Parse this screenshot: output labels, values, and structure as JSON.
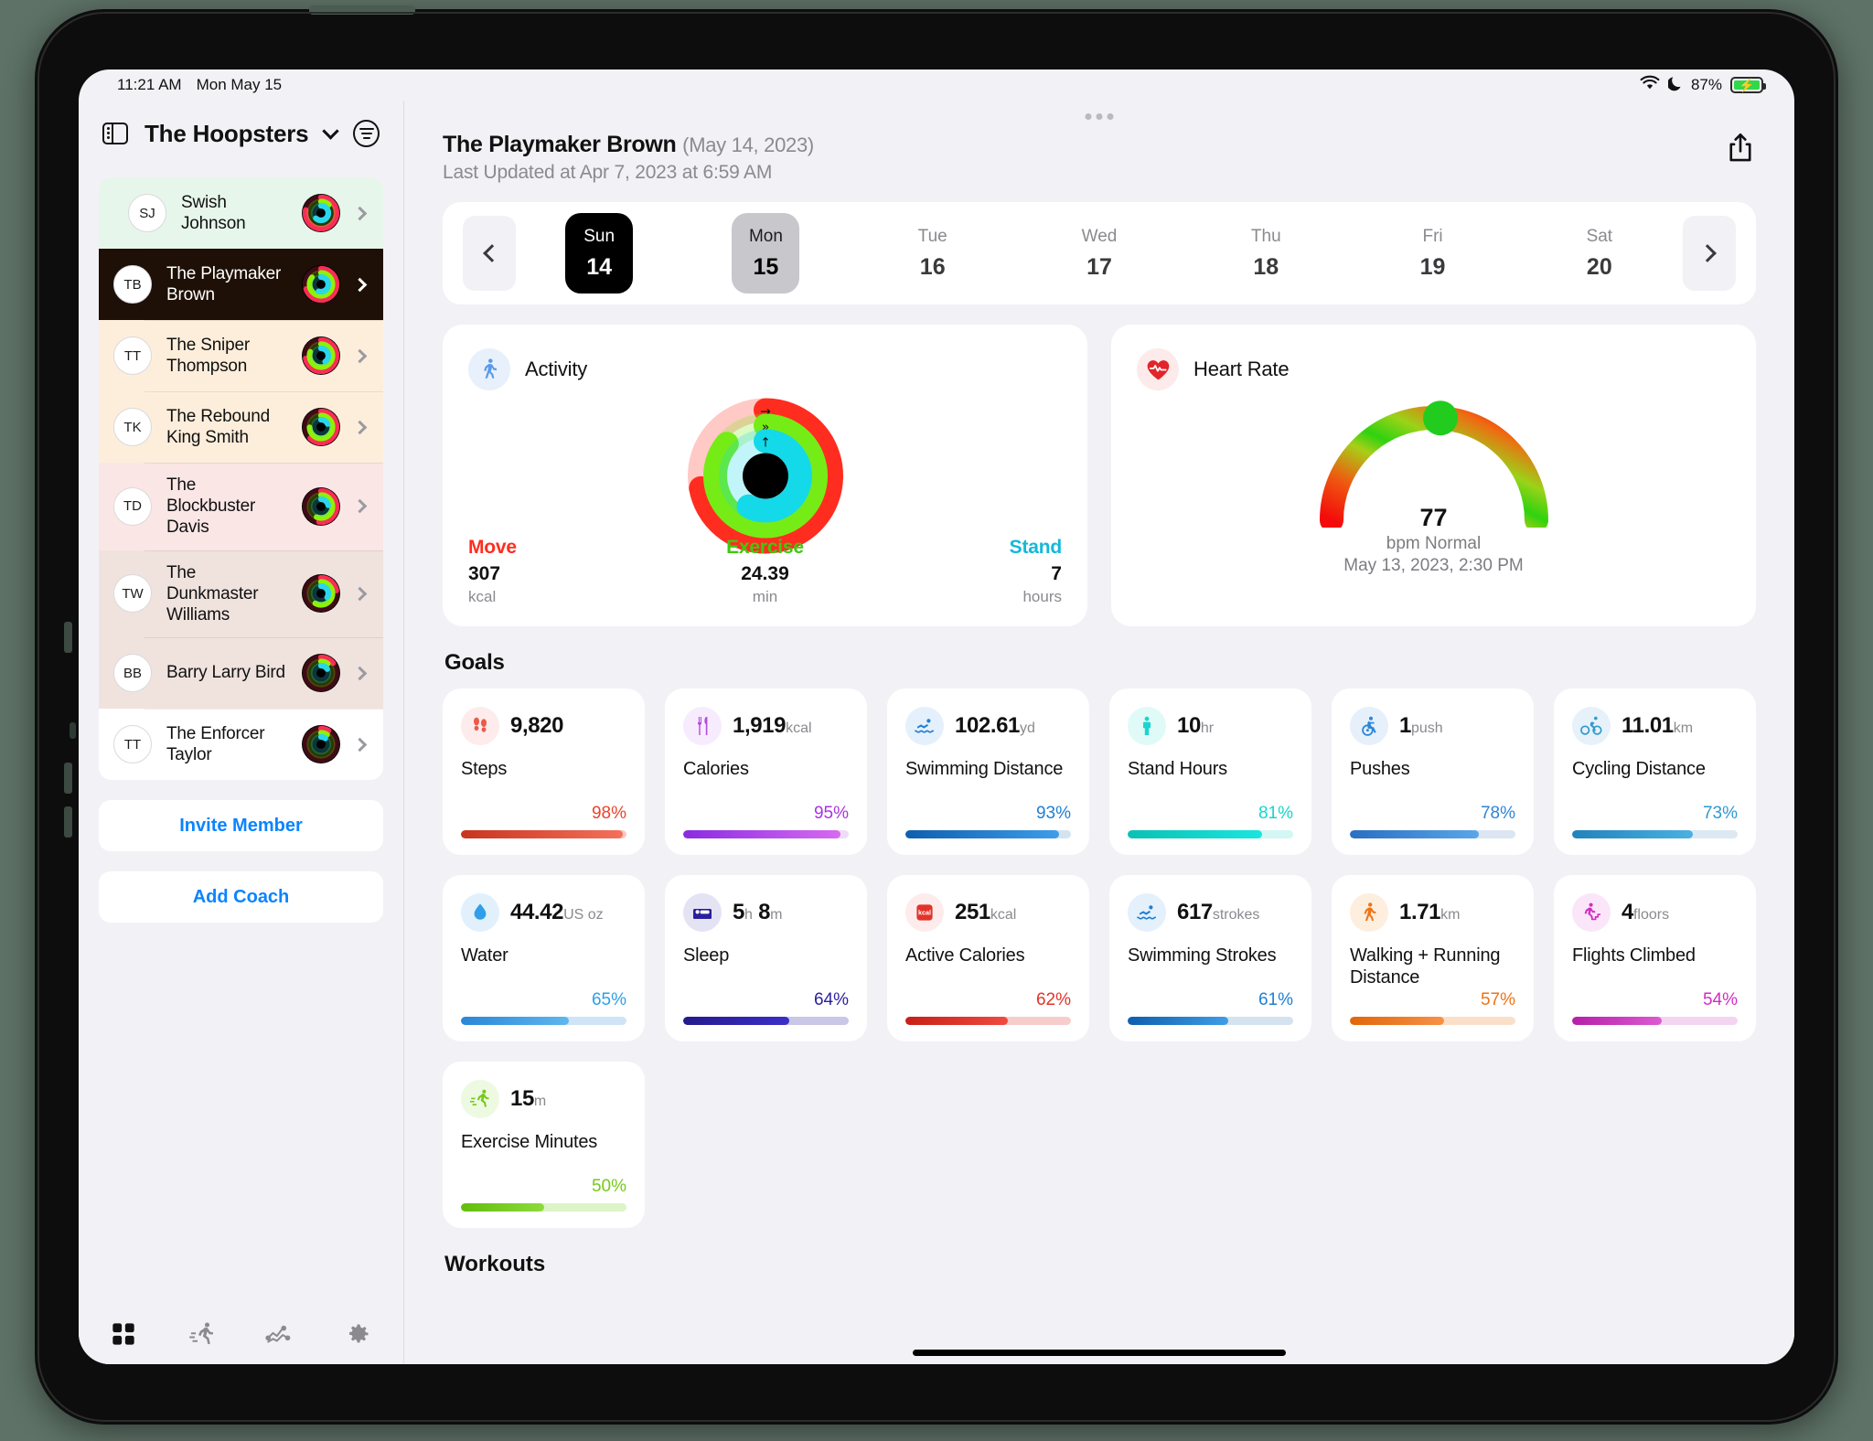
{
  "status_bar": {
    "time": "11:21 AM",
    "date": "Mon May 15",
    "battery": "87%",
    "wifi_icon": "wifi-icon",
    "dnd_icon": "moon-icon",
    "battery_icon": "battery-charging-icon"
  },
  "sidebar": {
    "title": "The Hoopsters",
    "toggle_icon": "sidebar-toggle-icon",
    "chevron_icon": "chevron-down-icon",
    "filter_icon": "filter-icon",
    "members": [
      {
        "initials": "SJ",
        "name": "Swish Johnson",
        "bg": "#e7f6ea",
        "selected": false,
        "rings": {
          "move": 0.78,
          "exercise": 0.12,
          "stand": 0.62
        }
      },
      {
        "initials": "TB",
        "name": "The Playmaker Brown",
        "bg": "#1e1006",
        "selected": true,
        "rings": {
          "move": 0.7,
          "exercise": 0.85,
          "stand": 0.55
        }
      },
      {
        "initials": "TT",
        "name": "The Sniper Thompson",
        "bg": "#fdeedb",
        "selected": false,
        "rings": {
          "move": 0.72,
          "exercise": 0.8,
          "stand": 0.4
        }
      },
      {
        "initials": "TK",
        "name": "The Rebound King Smith",
        "bg": "#fdeedb",
        "selected": false,
        "rings": {
          "move": 0.62,
          "exercise": 0.74,
          "stand": 0.18
        }
      },
      {
        "initials": "TD",
        "name": "The Blockbuster Davis",
        "bg": "#fbe6e6",
        "selected": false,
        "rings": {
          "move": 0.52,
          "exercise": 0.56,
          "stand": 0.22
        }
      },
      {
        "initials": "TW",
        "name": "The Dunkmaster Williams",
        "bg": "#f0e3de",
        "selected": false,
        "rings": {
          "move": 0.22,
          "exercise": 0.58,
          "stand": 0.34
        }
      },
      {
        "initials": "BB",
        "name": "Barry Larry Bird",
        "bg": "#f0e3de",
        "selected": false,
        "rings": {
          "move": 0.14,
          "exercise": 0.1,
          "stand": 0.16
        }
      },
      {
        "initials": "TT",
        "name": "The Enforcer Taylor",
        "bg": "#ffffff",
        "selected": false,
        "rings": {
          "move": 0.08,
          "exercise": 0.09,
          "stand": 0.1
        }
      }
    ],
    "invite_label": "Invite Member",
    "add_coach_label": "Add Coach",
    "tabs": [
      {
        "icon": "grid-icon",
        "active": true
      },
      {
        "icon": "running-icon",
        "active": false
      },
      {
        "icon": "chart-line-icon",
        "active": false
      },
      {
        "icon": "gear-icon",
        "active": false
      }
    ]
  },
  "header": {
    "title": "The Playmaker Brown",
    "date": "(May 14, 2023)",
    "subtitle": "Last Updated at Apr 7, 2023 at 6:59 AM",
    "share_icon": "share-icon"
  },
  "date_strip": {
    "prev_icon": "chevron-left-icon",
    "next_icon": "chevron-right-icon",
    "days": [
      {
        "dow": "Sun",
        "num": "14",
        "state": "dark"
      },
      {
        "dow": "Mon",
        "num": "15",
        "state": "grey"
      },
      {
        "dow": "Tue",
        "num": "16",
        "state": "plain"
      },
      {
        "dow": "Wed",
        "num": "17",
        "state": "plain"
      },
      {
        "dow": "Thu",
        "num": "18",
        "state": "plain"
      },
      {
        "dow": "Fri",
        "num": "19",
        "state": "plain"
      },
      {
        "dow": "Sat",
        "num": "20",
        "state": "plain"
      }
    ]
  },
  "activity": {
    "label": "Activity",
    "icon": "walking-icon",
    "move": {
      "label": "Move",
      "value": "307",
      "unit": "kcal",
      "color": "#ff2d20",
      "progress": 0.72
    },
    "exercise": {
      "label": "Exercise",
      "value": "24.39",
      "unit": "min",
      "color": "#76ec17",
      "progress": 0.86
    },
    "stand": {
      "label": "Stand",
      "value": "7",
      "unit": "hours",
      "color": "#14d9e8",
      "progress": 0.58
    }
  },
  "heart_rate": {
    "label": "Heart Rate",
    "icon": "heart-pulse-icon",
    "bpm": "77",
    "status": "bpm Normal",
    "timestamp": "May 13, 2023, 2:30 PM",
    "needle_position": 0.52
  },
  "goals": {
    "title": "Goals",
    "cards": [
      {
        "icon": "footsteps-icon",
        "value": "9,820",
        "unit": "",
        "unit2": "",
        "label": "Steps",
        "pct": "98%",
        "pct_num": 98,
        "color": "#e8452c",
        "bar_from": "#c8351f",
        "bar_to": "#f4705c",
        "track": "#f9c8bf",
        "icon_bg": "#fdeceb"
      },
      {
        "icon": "cutlery-icon",
        "value": "1,919",
        "unit": "kcal",
        "unit2": "",
        "label": "Calories",
        "pct": "95%",
        "pct_num": 95,
        "color": "#a933e0",
        "bar_from": "#8a2be2",
        "bar_to": "#d66bf0",
        "track": "#eddcf7",
        "icon_bg": "#f7ecfd"
      },
      {
        "icon": "swimmer-icon",
        "value": "102.61",
        "unit": "yd",
        "unit2": "",
        "label": "Swimming Distance",
        "pct": "93%",
        "pct_num": 93,
        "color": "#1f7fd4",
        "bar_from": "#0e5fae",
        "bar_to": "#3f9de8",
        "track": "#d5e3f1",
        "icon_bg": "#e4f0fb"
      },
      {
        "icon": "stand-person-icon",
        "value": "10",
        "unit": "hr",
        "unit2": "",
        "label": "Stand Hours",
        "pct": "81%",
        "pct_num": 81,
        "color": "#17d6cd",
        "bar_from": "#0bc0b4",
        "bar_to": "#1ae6de",
        "track": "#d3f7f4",
        "icon_bg": "#e0faf7"
      },
      {
        "icon": "wheelchair-icon",
        "value": "1",
        "unit": "push",
        "unit2": "",
        "label": "Pushes",
        "pct": "78%",
        "pct_num": 78,
        "color": "#2e85d6",
        "bar_from": "#2a6fc2",
        "bar_to": "#5aa6e8",
        "track": "#dbe6f2",
        "icon_bg": "#e6f0fa"
      },
      {
        "icon": "cycling-icon",
        "value": "11.01",
        "unit": "km",
        "unit2": "",
        "label": "Cycling Distance",
        "pct": "73%",
        "pct_num": 73,
        "color": "#2e9ad0",
        "bar_from": "#2083bb",
        "bar_to": "#4bb1e0",
        "track": "#dce9f2",
        "icon_bg": "#e6f1fa"
      },
      {
        "icon": "water-drop-icon",
        "value": "44.42",
        "unit": "US oz",
        "unit2": "",
        "label": "Water",
        "pct": "65%",
        "pct_num": 65,
        "color": "#2e9fe8",
        "bar_from": "#2a86d8",
        "bar_to": "#5fb7ee",
        "track": "#cfe4f7",
        "icon_bg": "#e2f0fc"
      },
      {
        "icon": "bed-icon",
        "value": "5",
        "unit": "h",
        "unit2": "m",
        "value2": "8",
        "label": "Sleep",
        "pct": "64%",
        "pct_num": 64,
        "color": "#2a1f9e",
        "bar_from": "#241a8c",
        "bar_to": "#3b2fc9",
        "track": "#c9c6e6",
        "icon_bg": "#e4e3f3"
      },
      {
        "icon": "kcal-badge-icon",
        "value": "251",
        "unit": "kcal",
        "unit2": "",
        "label": "Active Calories",
        "pct": "62%",
        "pct_num": 62,
        "color": "#e2332a",
        "bar_from": "#c81f16",
        "bar_to": "#ef4b41",
        "track": "#f7cdcb",
        "icon_bg": "#fdeceb"
      },
      {
        "icon": "swimmer-icon",
        "value": "617",
        "unit": "strokes",
        "unit2": "",
        "label": "Swimming Strokes",
        "pct": "61%",
        "pct_num": 61,
        "color": "#1f7fd4",
        "bar_from": "#0e5fae",
        "bar_to": "#3f9de8",
        "track": "#d5e3f1",
        "icon_bg": "#e4f0fb"
      },
      {
        "icon": "walking-orange-icon",
        "value": "1.71",
        "unit": "km",
        "unit2": "",
        "label": "Walking + Running Distance",
        "pct": "57%",
        "pct_num": 57,
        "color": "#ef7316",
        "bar_from": "#e0660a",
        "bar_to": "#f79246",
        "track": "#fbe0c9",
        "icon_bg": "#fdeede"
      },
      {
        "icon": "stairs-icon",
        "value": "4",
        "unit": "floors",
        "unit2": "",
        "label": "Flights Climbed",
        "pct": "54%",
        "pct_num": 54,
        "color": "#cf2fc0",
        "bar_from": "#b520a8",
        "bar_to": "#dd5ad2",
        "track": "#f4d5f0",
        "icon_bg": "#fae6f8"
      },
      {
        "icon": "runner-icon",
        "value": "15",
        "unit": "m",
        "unit2": "",
        "label": "Exercise Minutes",
        "pct": "50%",
        "pct_num": 50,
        "color": "#76c91a",
        "bar_from": "#62bd0a",
        "bar_to": "#8ddb3c",
        "track": "#ddf3c8",
        "icon_bg": "#eef9e2"
      }
    ]
  },
  "workouts": {
    "title": "Workouts"
  }
}
